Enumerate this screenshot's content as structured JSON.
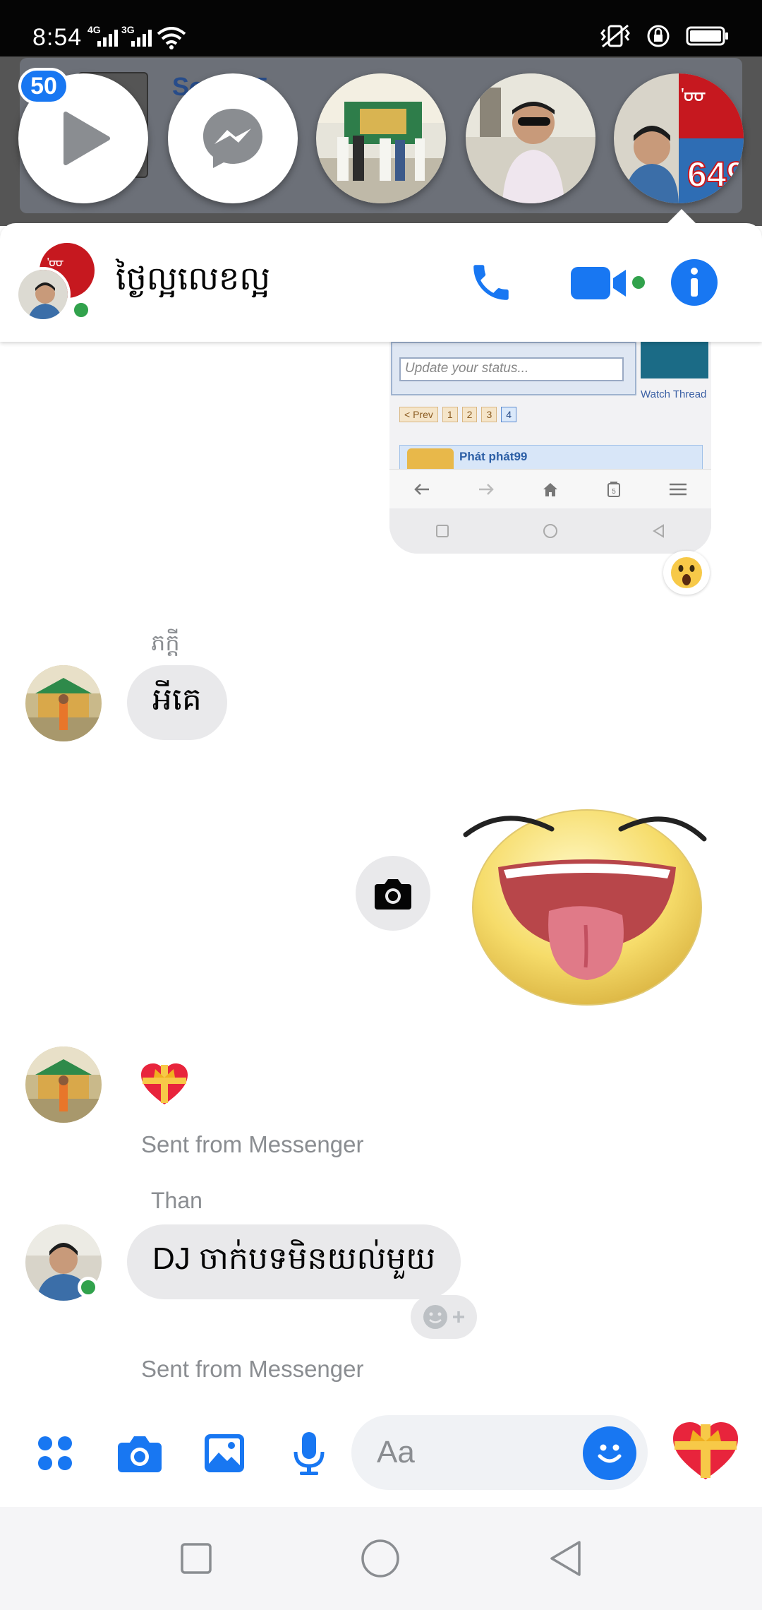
{
  "status_bar": {
    "time": "8:54",
    "network_1": "4G",
    "network_2": "3G"
  },
  "background_notification": {
    "text": "So   1985"
  },
  "chat_heads": {
    "unread_badge": "50",
    "items": [
      "video-player-head",
      "messenger-head",
      "group-photo-head",
      "man-sunglasses-head",
      "lotto-649-head"
    ]
  },
  "conversation_header": {
    "title": "ថ្ងៃល្អលេខល្អ",
    "accent_color": "#1877f2",
    "online_color": "#31a24c"
  },
  "shared_screenshot": {
    "status_placeholder": "Update your status...",
    "watch_thread": "Watch Thread",
    "pager": [
      "< Prev",
      "1",
      "2",
      "3",
      "4"
    ],
    "post_author": "Phát phát99",
    "tab_count": "5"
  },
  "messages": [
    {
      "sender": "ភក្តី",
      "text": "អីគេ"
    },
    {
      "sender": "",
      "footer": "Sent from Messenger"
    },
    {
      "sender": "Than",
      "text": "DJ ចាក់បទមិនយល់មួយ",
      "footer": "Sent from Messenger"
    }
  ],
  "composer": {
    "placeholder": "Aa"
  }
}
